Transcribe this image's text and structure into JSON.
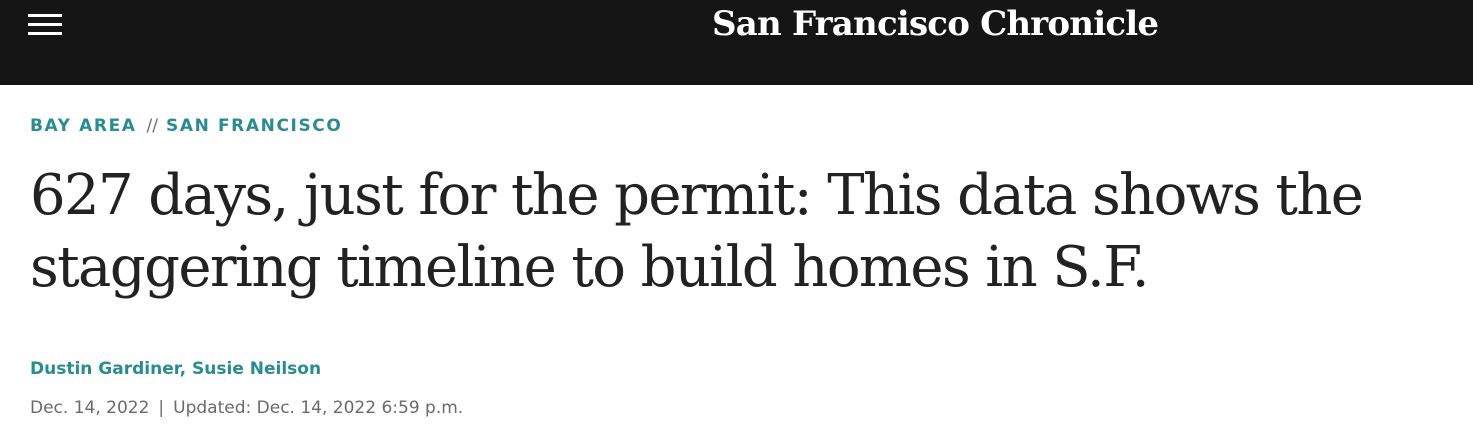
{
  "header": {
    "menu_icon": "hamburger-menu-icon",
    "masthead": "San Francisco Chronicle",
    "background": "#151515"
  },
  "breadcrumb": {
    "section": "BAY AREA",
    "separator": "//",
    "subsection": "SAN FRANCISCO",
    "color": "#2a8b91"
  },
  "article": {
    "headline": "627 days, just for the permit: This data shows the staggering timeline to build homes in S.F.",
    "authors": {
      "first": "Dustin Gardiner",
      "joiner": ", ",
      "second": "Susie Neilson"
    },
    "published": "Dec. 14, 2022",
    "divider": "|",
    "updated": "Updated: Dec. 14, 2022 6:59 p.m."
  }
}
